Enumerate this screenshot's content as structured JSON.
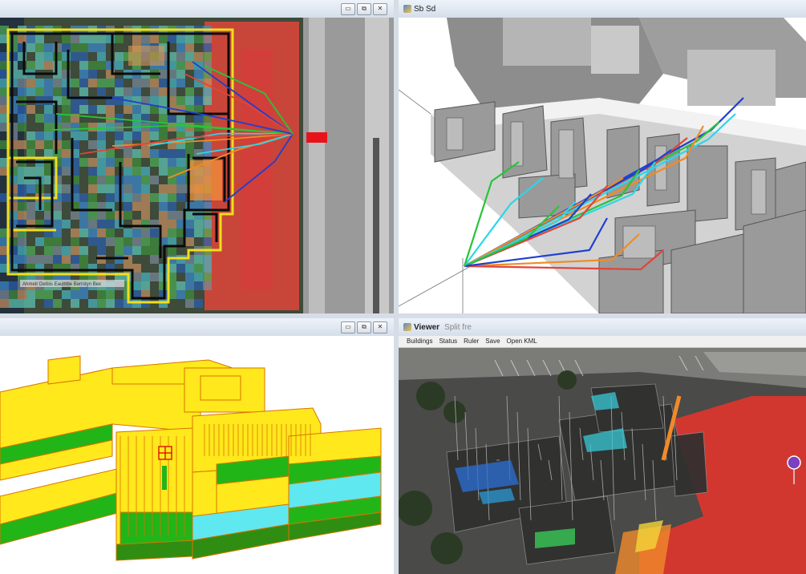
{
  "windows": {
    "top_left": {
      "title": ""
    },
    "top_right": {
      "title": "Sb Sd"
    },
    "bottom_left": {
      "title": ""
    },
    "bottom_right": {
      "title": "Viewer",
      "subtitle": "Split fre"
    }
  },
  "buttons": {
    "minimize": "▭",
    "restore": "⧉",
    "close": "✕"
  },
  "viewer_menu": [
    "Buildings",
    "Status",
    "Ruler",
    "Save",
    "Open KML"
  ],
  "map_caption": "Ahmetr Detbis Eaumbe Berrstyn Bex",
  "colors": {
    "coverage_red": "#e0453a",
    "building_yellow": "#ffe81c",
    "floor_green": "#22b518",
    "floor_cyan": "#5fe8ef",
    "ray_blue": "#1f3fd1",
    "ray_green": "#28c43a",
    "ray_cyan": "#2cd6e8",
    "ray_orange": "#f08c24"
  }
}
